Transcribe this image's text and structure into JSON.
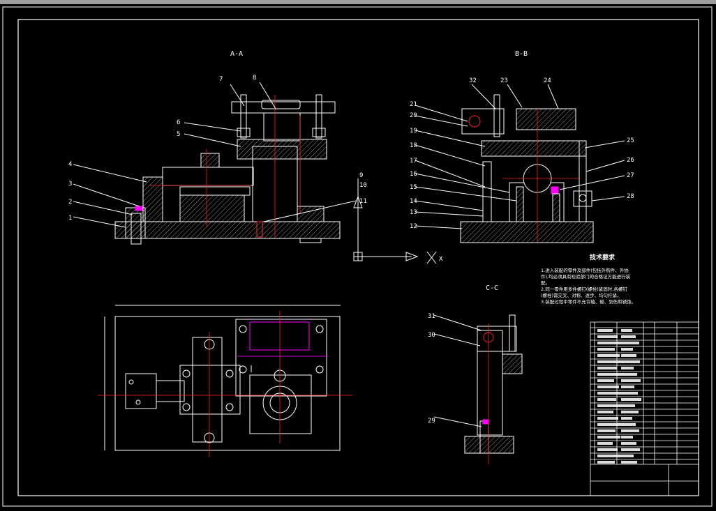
{
  "views": {
    "aa": "A-A",
    "bb": "B-B",
    "cc": "C-C"
  },
  "axis": {
    "x": "X"
  },
  "labels_aa": [
    "7",
    "8",
    "6",
    "5",
    "4",
    "3",
    "2",
    "1",
    "9",
    "10",
    "11"
  ],
  "labels_bb": [
    "32",
    "23",
    "24",
    "21",
    "20",
    "19",
    "18",
    "17",
    "16",
    "15",
    "14",
    "13",
    "12",
    "25",
    "26",
    "27",
    "28"
  ],
  "labels_cc": [
    "31",
    "30",
    "29"
  ],
  "tech": {
    "title": "技术要求",
    "lines": [
      "1.进入装配的零件及部件(包括外购件、外协",
      "件),均必须具有检验部门的合格证方能进行装",
      "配。",
      "2.同一零件用多件螺钉(螺栓)紧固时,各螺钉",
      "(螺栓)需交叉、对称、逐步、均匀拧紧。",
      "3.装配过程中零件不允许磕、碰、划伤和锈蚀。"
    ]
  },
  "colors": {
    "line": "#ffffff",
    "center": "#ff2020",
    "magenta": "#ff00ff",
    "hatch": "#d0d0d0",
    "topbar": "#9e9e9e"
  }
}
